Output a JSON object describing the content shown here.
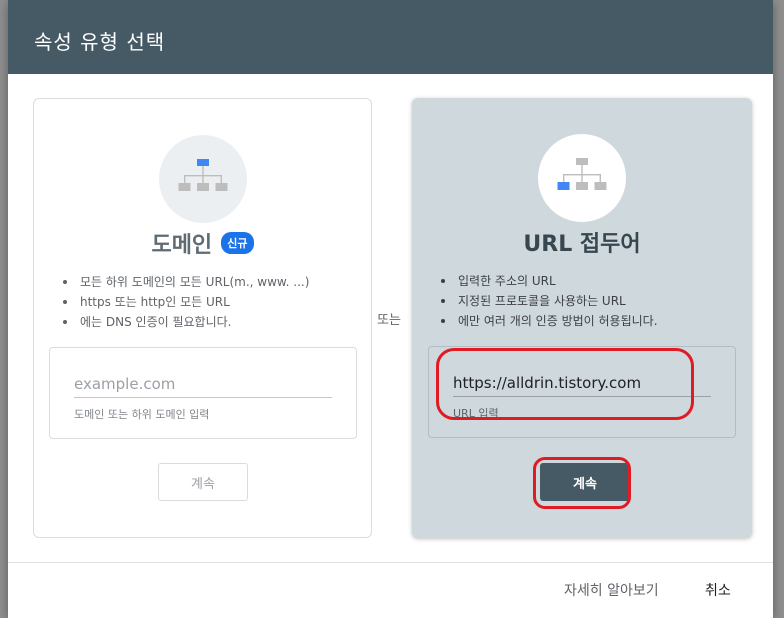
{
  "dialog": {
    "title": "속성 유형 선택",
    "or_label": "또는"
  },
  "domain_card": {
    "title": "도메인",
    "badge": "신규",
    "bullets": [
      "모든 하위 도메인의 모든 URL(m., www. ...)",
      "https 또는 http인 모든 URL",
      "에는 DNS 인증이 필요합니다."
    ],
    "input_placeholder": "example.com",
    "input_value": "",
    "input_hint": "도메인 또는 하위 도메인 입력",
    "continue_label": "계속",
    "icon": "sitemap-icon"
  },
  "url_card": {
    "title": "URL 접두어",
    "bullets": [
      "입력한 주소의 URL",
      "지정된 프로토콜을 사용하는 URL",
      "에만 여러 개의 인증 방법이 허용됩니다."
    ],
    "input_value": "https://alldrin.tistory.com",
    "input_hint": "URL 입력",
    "continue_label": "계속",
    "icon": "sitemap-icon"
  },
  "footer": {
    "learn_more": "자세히 알아보기",
    "cancel": "취소"
  },
  "colors": {
    "header": "#455a64",
    "accent": "#1a73e8",
    "url_card_bg": "#cfd8dc",
    "annotation": "#e01b24"
  }
}
